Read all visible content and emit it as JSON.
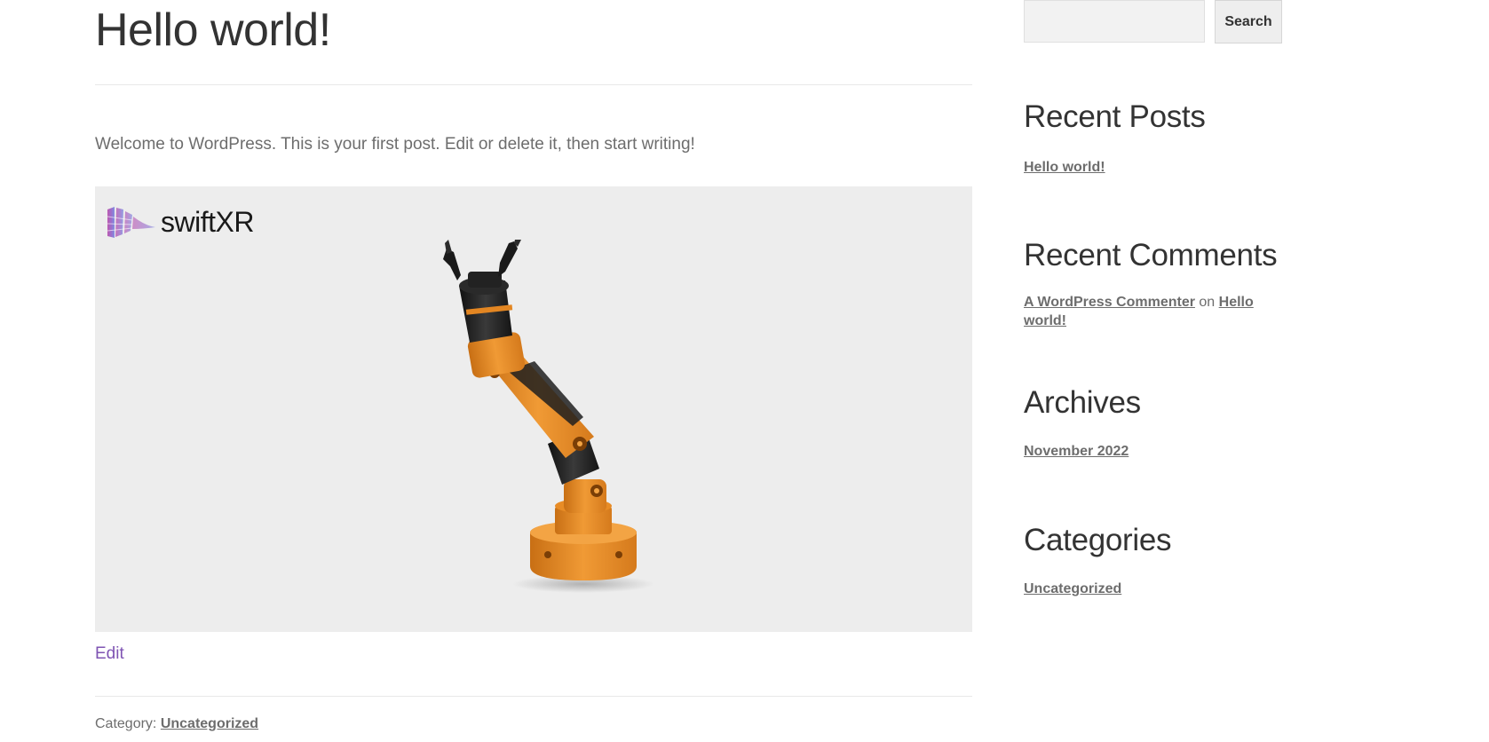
{
  "post": {
    "title": "Hello world!",
    "intro": "Welcome to WordPress. This is your first post. Edit or delete it, then start writing!",
    "embed": {
      "logo_text": "swiftXR",
      "background": "#ededed"
    },
    "edit_label": "Edit",
    "category_prefix": "Category:",
    "category_link": "Uncategorized"
  },
  "sidebar": {
    "search": {
      "placeholder": "",
      "button_label": "Search"
    },
    "recent_posts": {
      "title": "Recent Posts",
      "items": [
        "Hello world!"
      ]
    },
    "recent_comments": {
      "title": "Recent Comments",
      "author": "A WordPress Commenter",
      "connector": "on",
      "post": "Hello world!"
    },
    "archives": {
      "title": "Archives",
      "items": [
        "November 2022"
      ]
    },
    "categories": {
      "title": "Categories",
      "items": [
        "Uncategorized"
      ]
    }
  },
  "colors": {
    "link_purple": "#7f54b3",
    "text": "#6d6d6d",
    "heading": "#333333",
    "robot_orange": "#e8902a"
  }
}
